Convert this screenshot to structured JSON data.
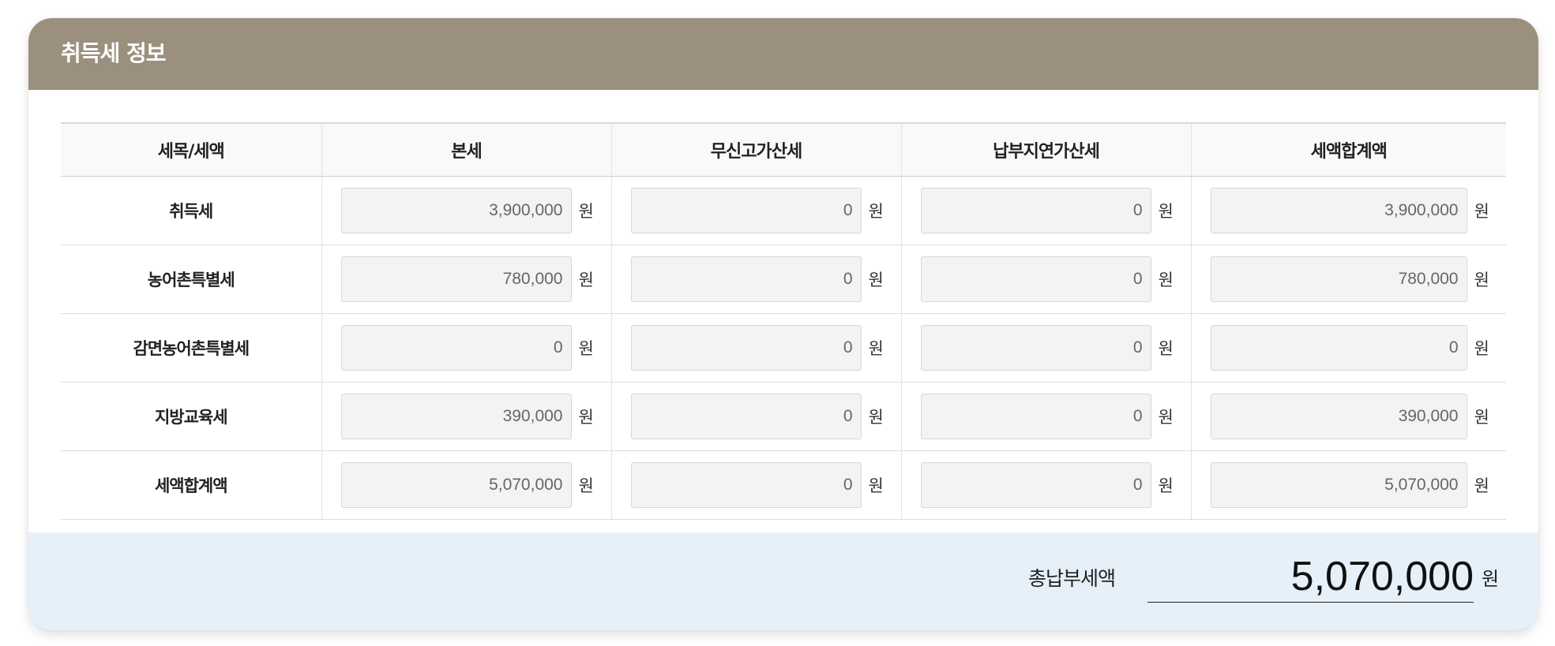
{
  "title": "취득세 정보",
  "table": {
    "headers": [
      "세목/세액",
      "본세",
      "무신고가산세",
      "납부지연가산세",
      "세액합계액"
    ],
    "unit": "원",
    "rows": [
      {
        "label": "취득세",
        "values": [
          "3,900,000",
          "0",
          "0",
          "3,900,000"
        ]
      },
      {
        "label": "농어촌특별세",
        "values": [
          "780,000",
          "0",
          "0",
          "780,000"
        ]
      },
      {
        "label": "감면농어촌특별세",
        "values": [
          "0",
          "0",
          "0",
          "0"
        ]
      },
      {
        "label": "지방교육세",
        "values": [
          "390,000",
          "0",
          "0",
          "390,000"
        ]
      },
      {
        "label": "세액합계액",
        "values": [
          "5,070,000",
          "0",
          "0",
          "5,070,000"
        ]
      }
    ]
  },
  "total": {
    "label": "총납부세액",
    "value": "5,070,000",
    "unit": "원"
  },
  "colors": {
    "header_bg": "#9b907e",
    "total_bg": "#e6f0f9",
    "input_bg": "#f3f3f3"
  }
}
